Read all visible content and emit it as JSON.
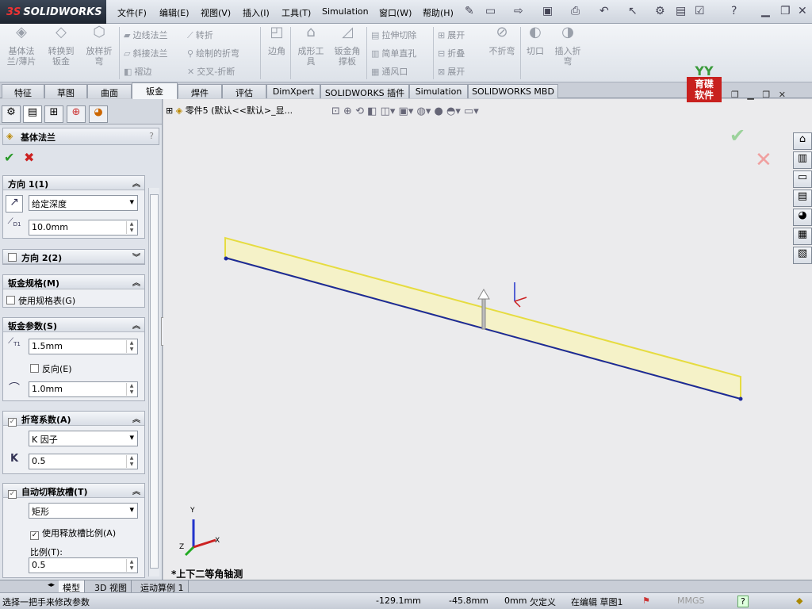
{
  "app": {
    "logo": "SOLIDWORKS",
    "logo_mark": "3S"
  },
  "menu": [
    "文件(F)",
    "编辑(E)",
    "视图(V)",
    "插入(I)",
    "工具(T)",
    "Simulation",
    "窗口(W)",
    "帮助(H)"
  ],
  "quick_access_icons": [
    "pin-icon",
    "new-doc-icon",
    "open-icon",
    "save-icon",
    "print-icon",
    "undo-icon",
    "select-icon",
    "rebuild-icon",
    "file-properties-icon",
    "options-icon",
    "help-icon"
  ],
  "command_manager": {
    "big_buttons": [
      {
        "label": "基体法\n兰/薄片",
        "icon": "base-flange-icon"
      },
      {
        "label": "转换到\n钣金",
        "icon": "convert-sheetmetal-icon"
      },
      {
        "label": "放样折\n弯",
        "icon": "lofted-bend-icon"
      },
      {
        "label": "边角",
        "icon": "corners-icon"
      },
      {
        "label": "成形工\n具",
        "icon": "forming-tool-icon"
      },
      {
        "label": "钣金角\n撑板",
        "icon": "gusset-icon"
      },
      {
        "label": "不折弯",
        "icon": "no-bends-icon"
      },
      {
        "label": "切口",
        "icon": "rip-icon"
      },
      {
        "label": "插入折\n弯",
        "icon": "insert-bends-icon"
      }
    ],
    "small_buttons": [
      {
        "label": "边线法兰",
        "icon": "edge-flange-icon"
      },
      {
        "label": "斜接法兰",
        "icon": "miter-flange-icon"
      },
      {
        "label": "褶边",
        "icon": "hem-icon"
      },
      {
        "label": "转折",
        "icon": "jog-icon"
      },
      {
        "label": "绘制的折弯",
        "icon": "sketched-bend-icon"
      },
      {
        "label": "交叉-折断",
        "icon": "cross-break-icon"
      },
      {
        "label": "拉伸切除",
        "icon": "extruded-cut-icon"
      },
      {
        "label": "简单直孔",
        "icon": "simple-hole-icon"
      },
      {
        "label": "通风口",
        "icon": "vent-icon"
      },
      {
        "label": "展开",
        "icon": "unfold-icon"
      },
      {
        "label": "折叠",
        "icon": "fold-icon"
      },
      {
        "label": "展开",
        "icon": "flatten-icon"
      }
    ]
  },
  "tabs": [
    "特征",
    "草图",
    "曲面",
    "钣金",
    "焊件",
    "评估",
    "DimXpert",
    "SOLIDWORKS 插件",
    "Simulation",
    "SOLIDWORKS MBD"
  ],
  "active_tab": "钣金",
  "property_manager": {
    "title": "基体法兰",
    "help": "?",
    "direction1": {
      "header": "方向 1(1)",
      "end_condition": "给定深度",
      "depth": "10.0mm",
      "depth_label": "D1"
    },
    "direction2": {
      "header": "方向 2(2)"
    },
    "gauge": {
      "header": "钣金规格(M)",
      "use_gauge_table": "使用规格表(G)"
    },
    "params": {
      "header": "钣金参数(S)",
      "thickness": "1.5mm",
      "thickness_label": "T1",
      "reverse": "反向(E)",
      "radius": "1.0mm"
    },
    "bend_allowance": {
      "header": "折弯系数(A)",
      "type": "K 因子",
      "k_label": "K",
      "k_value": "0.5"
    },
    "auto_relief": {
      "header": "自动切释放槽(T)",
      "type": "矩形",
      "use_ratio": "使用释放槽比例(A)",
      "ratio_label": "比例(T):",
      "ratio_value": "0.5"
    }
  },
  "graphics": {
    "tree_item": "零件5 (默认<<默认>_显...",
    "view_name": "*上下二等角轴测",
    "watermark_top": "YY",
    "watermark_text": "育碟\n软件",
    "axis_labels": {
      "x": "X",
      "y": "Y",
      "z": "Z"
    }
  },
  "bottom_tabs": [
    "模型",
    "3D 视图",
    "运动算例 1"
  ],
  "status": {
    "message": "选择一把手来修改参数",
    "x": "-129.1mm",
    "y": "-45.8mm",
    "z": "0mm",
    "state": "欠定义",
    "editing": "在编辑 草图1",
    "units": "MMGS",
    "help": "?"
  }
}
